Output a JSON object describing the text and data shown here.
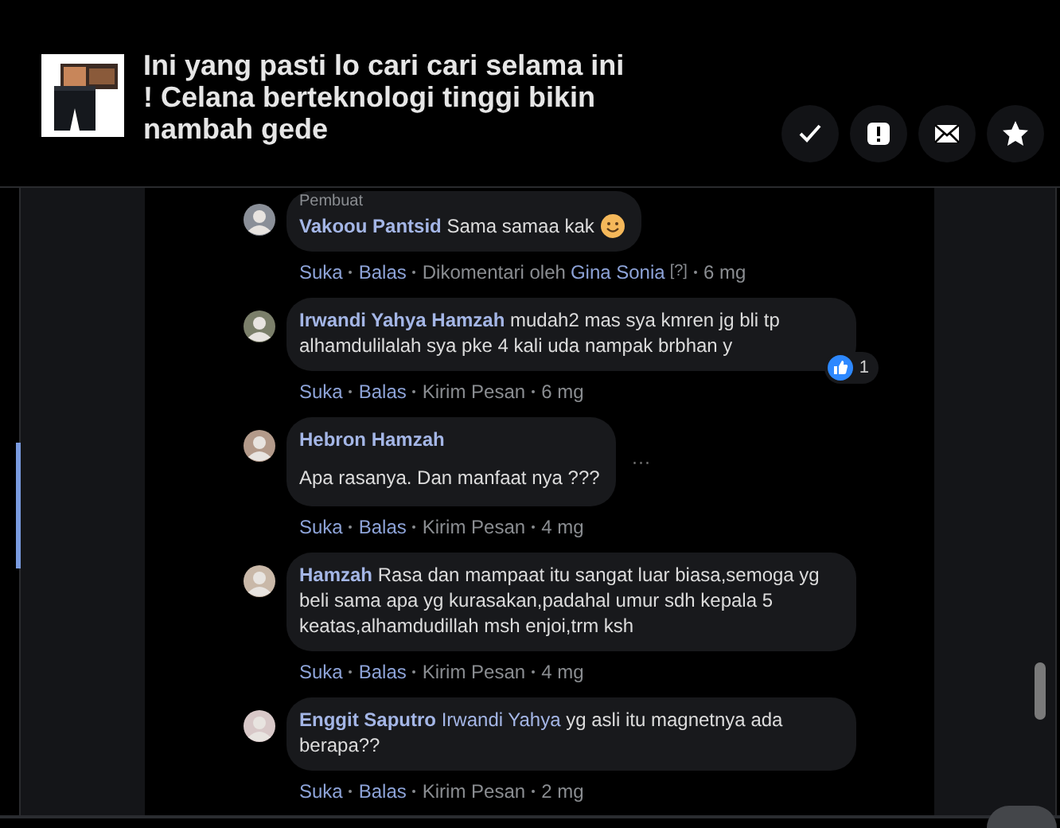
{
  "post": {
    "title": "Ini yang pasti lo cari cari selama ini ! Celana berteknologi tinggi bikin nambah gede"
  },
  "header_buttons": [
    {
      "kind": "check"
    },
    {
      "kind": "report"
    },
    {
      "kind": "mail"
    },
    {
      "kind": "star"
    }
  ],
  "comments": [
    {
      "badge": "Pembuat",
      "name": "Vakoou Pantsid",
      "text": "Sama samaa kak",
      "emoji": true,
      "text_on_new_line": false,
      "actions": [
        {
          "text": "Suka",
          "kind": "link"
        },
        {
          "text": "Balas",
          "kind": "link"
        },
        {
          "text": "Dikomentari oleh",
          "kind": "meta"
        },
        {
          "text": "Gina Sonia",
          "kind": "name"
        },
        {
          "text": "[?]",
          "kind": "hint"
        },
        {
          "text": "6 mg",
          "kind": "meta"
        }
      ]
    },
    {
      "name": "Irwandi Yahya Hamzah",
      "text": "mudah2 mas sya kmren jg bli tp alhamdulilalah sya pke 4 kali uda nampak brbhan y",
      "text_on_new_line": false,
      "reactions": "1",
      "actions": [
        {
          "text": "Suka",
          "kind": "link"
        },
        {
          "text": "Balas",
          "kind": "link"
        },
        {
          "text": "Kirim Pesan",
          "kind": "meta"
        },
        {
          "text": "6 mg",
          "kind": "meta"
        }
      ]
    },
    {
      "name": "Hebron Hamzah",
      "text": "Apa rasanya. Dan manfaat nya ???",
      "text_on_new_line": true,
      "more": "···",
      "actions": [
        {
          "text": "Suka",
          "kind": "link"
        },
        {
          "text": "Balas",
          "kind": "link"
        },
        {
          "text": "Kirim Pesan",
          "kind": "meta"
        },
        {
          "text": "4 mg",
          "kind": "meta"
        }
      ]
    },
    {
      "name": "Hamzah",
      "text": "Rasa dan mampaat itu sangat luar biasa,semoga yg beli sama apa yg kurasakan,padahal umur sdh kepala 5 keatas,alhamdudillah msh enjoi,trm ksh",
      "text_on_new_line": false,
      "actions": [
        {
          "text": "Suka",
          "kind": "link"
        },
        {
          "text": "Balas",
          "kind": "link"
        },
        {
          "text": "Kirim Pesan",
          "kind": "meta"
        },
        {
          "text": "4 mg",
          "kind": "meta"
        }
      ]
    },
    {
      "name": "Enggit Saputro",
      "mention": "Irwandi Yahya",
      "text": "yg asli itu magnetnya ada berapa??",
      "text_on_new_line": false,
      "actions": [
        {
          "text": "Suka",
          "kind": "link"
        },
        {
          "text": "Balas",
          "kind": "link"
        },
        {
          "text": "Kirim Pesan",
          "kind": "meta"
        },
        {
          "text": "2 mg",
          "kind": "meta"
        }
      ]
    }
  ]
}
